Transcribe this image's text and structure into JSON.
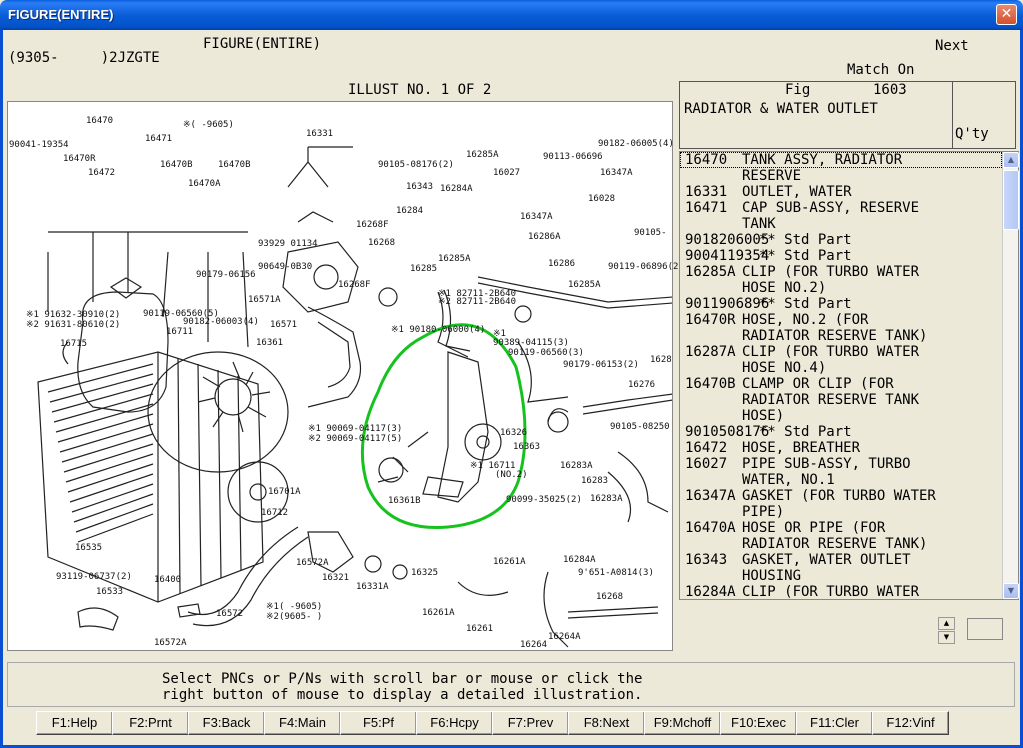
{
  "window": {
    "title": "FIGURE(ENTIRE)",
    "close_glyph": "✕"
  },
  "header": {
    "heading": "FIGURE(ENTIRE)",
    "model": "(9305-     )2JZGTE",
    "next_label": "Next",
    "match_label": "Match On",
    "illust_label": "ILLUST NO. 1 OF 2"
  },
  "figure_info": {
    "fig_label": "Fig",
    "fig_number": "1603",
    "name": "RADIATOR & WATER OUTLET",
    "qty_label": "Q'ty"
  },
  "parts": [
    {
      "pn": "16470",
      "desc": "TANK ASSY, RADIATOR"
    },
    {
      "pn": "",
      "desc": "RESERVE"
    },
    {
      "pn": "16331",
      "desc": "OUTLET, WATER"
    },
    {
      "pn": "16471",
      "desc": "CAP SUB-ASSY, RESERVE"
    },
    {
      "pn": "",
      "desc": "TANK"
    },
    {
      "pn": "9018206005",
      "desc": "  ** Std Part"
    },
    {
      "pn": "9004119354",
      "desc": "  ** Std Part"
    },
    {
      "pn": "16285A",
      "desc": "CLIP (FOR TURBO WATER"
    },
    {
      "pn": "",
      "desc": "HOSE NO.2)"
    },
    {
      "pn": "9011906896",
      "desc": "  ** Std Part"
    },
    {
      "pn": "16470R",
      "desc": "HOSE, NO.2 (FOR"
    },
    {
      "pn": "",
      "desc": "RADIATOR RESERVE TANK)"
    },
    {
      "pn": "16287A",
      "desc": "CLIP (FOR TURBO WATER"
    },
    {
      "pn": "",
      "desc": "HOSE NO.4)"
    },
    {
      "pn": "16470B",
      "desc": "CLAMP OR CLIP (FOR"
    },
    {
      "pn": "",
      "desc": "RADIATOR RESERVE TANK"
    },
    {
      "pn": "",
      "desc": "HOSE)"
    },
    {
      "pn": "9010508176",
      "desc": "  ** Std Part"
    },
    {
      "pn": "16472",
      "desc": "HOSE, BREATHER"
    },
    {
      "pn": "16027",
      "desc": "PIPE SUB-ASSY, TURBO"
    },
    {
      "pn": "",
      "desc": "WATER, NO.1"
    },
    {
      "pn": "16347A",
      "desc": "GASKET (FOR TURBO WATER"
    },
    {
      "pn": "",
      "desc": "PIPE)"
    },
    {
      "pn": "16470A",
      "desc": "HOSE OR PIPE (FOR"
    },
    {
      "pn": "",
      "desc": "RADIATOR RESERVE TANK)"
    },
    {
      "pn": "16343",
      "desc": "GASKET, WATER OUTLET"
    },
    {
      "pn": "",
      "desc": "HOUSING"
    },
    {
      "pn": "16284A",
      "desc": "CLIP (FOR TURBO WATER"
    }
  ],
  "diagram_labels": [
    "16470",
    "16471",
    "16472",
    "16470R",
    "16470B",
    "16470A",
    "16470B",
    "90041-19354",
    "※(   -9605)",
    "16331",
    "90105-08176(2)",
    "16285A",
    "16027",
    "90113-06696",
    "16347A",
    "16028",
    "90182-06005(4)",
    "16343",
    "16284A",
    "16284",
    "16268F",
    "16268",
    "16347A",
    "16286A",
    "93929 01134",
    "90649-0B30",
    "90179-06156",
    "16268F",
    "16285",
    "16285A",
    "16286",
    "90105-",
    "90119-06896(2)",
    "16285A",
    "16571A",
    "※2 82711-2B640",
    "※1 82711-2B640",
    "※1 91632-30910(2)",
    "※2 91631-80610(2)",
    "90119-06560(5)",
    "16571",
    "16711",
    "90182-06003(4)",
    "16361",
    "16715",
    "※1 90180-06000(4)",
    "※1",
    "90389-04115(3)",
    "90119-06560(3)",
    "90179-06153(2)",
    "1628",
    "16276",
    "※1 90069-04117(3)",
    "※2 90069-04117(5)",
    "16326",
    "16363",
    "90105-08250",
    "※1 16711",
    "(NO.2)",
    "16283A",
    "16283",
    "16361B",
    "16701A",
    "16712",
    "16283A",
    "90099-35025(2)",
    "16535",
    "16572A",
    "16321",
    "16331A",
    "16325",
    "16400",
    "93119-06737(2)",
    "16533",
    "16261A",
    "16284A",
    "16268",
    "16572",
    "※1(    -9605)",
    "※2(9605-    )",
    "16261A",
    "16261",
    "16264A",
    "16264",
    "16572A",
    "9'651-A0814(3)"
  ],
  "status": {
    "line1": "Select PNCs or P/Ns with scroll bar or mouse or click the",
    "line2": "right button of mouse to display a detailed illustration."
  },
  "fkeys": [
    "F1:Help",
    "F2:Prnt",
    "F3:Back",
    "F4:Main",
    "F5:Pf",
    "F6:Hcpy",
    "F7:Prev",
    "F8:Next",
    "F9:Mchoff",
    "F10:Exec",
    "F11:Cler",
    "F12:Vinf"
  ]
}
